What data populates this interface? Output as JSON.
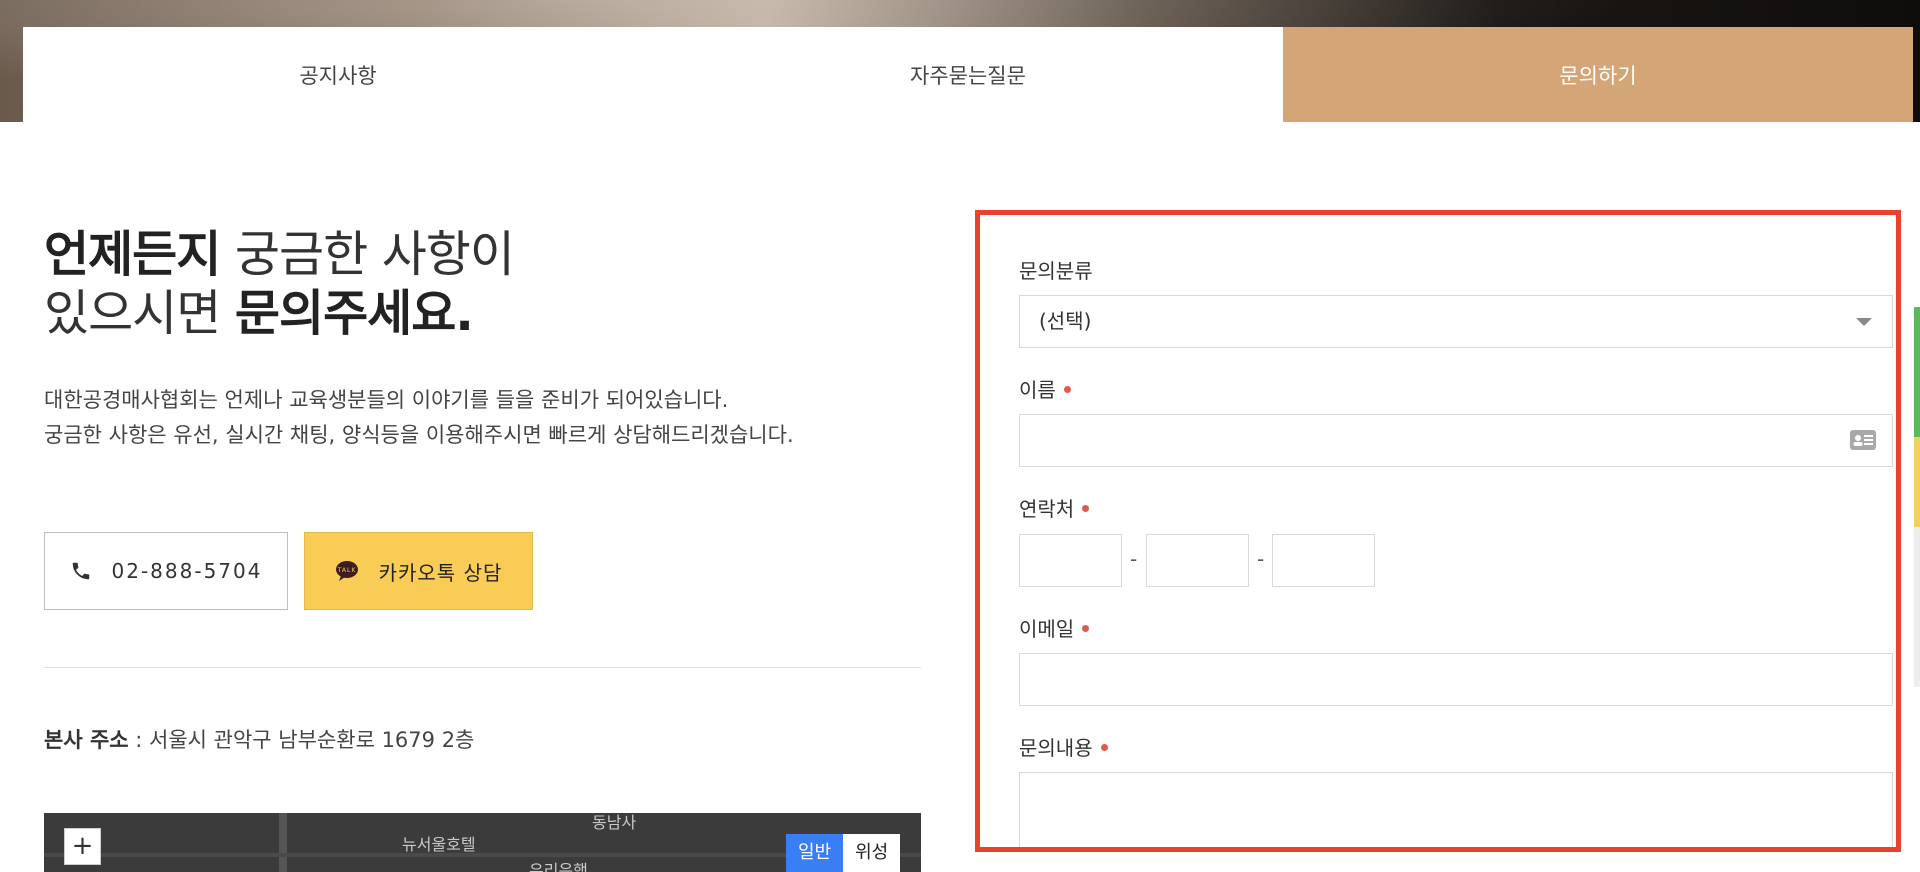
{
  "tabs": [
    {
      "label": "공지사항",
      "active": false
    },
    {
      "label": "자주묻는질문",
      "active": false
    },
    {
      "label": "문의하기",
      "active": true
    }
  ],
  "headline": {
    "line1_bold": "언제든지",
    "line1_rest": " 궁금한 사항이",
    "line2_rest": "있으시면 ",
    "line2_bold": "문의주세요."
  },
  "description": {
    "line1": "대한공경매사협회는 언제나 교육생분들의 이야기를 들을 준비가 되어있습니다.",
    "line2": "궁금한 사항은 유선, 실시간 채팅, 양식등을 이용해주시면 빠르게 상담해드리겠습니다."
  },
  "buttons": {
    "phone_label": "02-888-5704",
    "kakao_label": "카카오톡 상담",
    "kakao_badge": "TALK"
  },
  "address": {
    "label": "본사 주소",
    "separator": " : ",
    "value": "서울시 관악구 남부순환로 1679 2층"
  },
  "map": {
    "zoom_in_label": "+",
    "type_normal": "일반",
    "type_satellite": "위성",
    "labels": [
      "뉴서울호텔",
      "우리은행",
      "동남사"
    ]
  },
  "form": {
    "category_label": "문의분류",
    "category_value": "(선택)",
    "name_label": "이름",
    "contact_label": "연락처",
    "phone_separator": "-",
    "email_label": "이메일",
    "message_label": "문의내용"
  },
  "colors": {
    "accent_tab": "#d4a677",
    "kakao_yellow": "#f8cc55",
    "highlight_border": "#e8412c",
    "required_dot": "#e05a4a",
    "map_active": "#3a7ef3"
  }
}
